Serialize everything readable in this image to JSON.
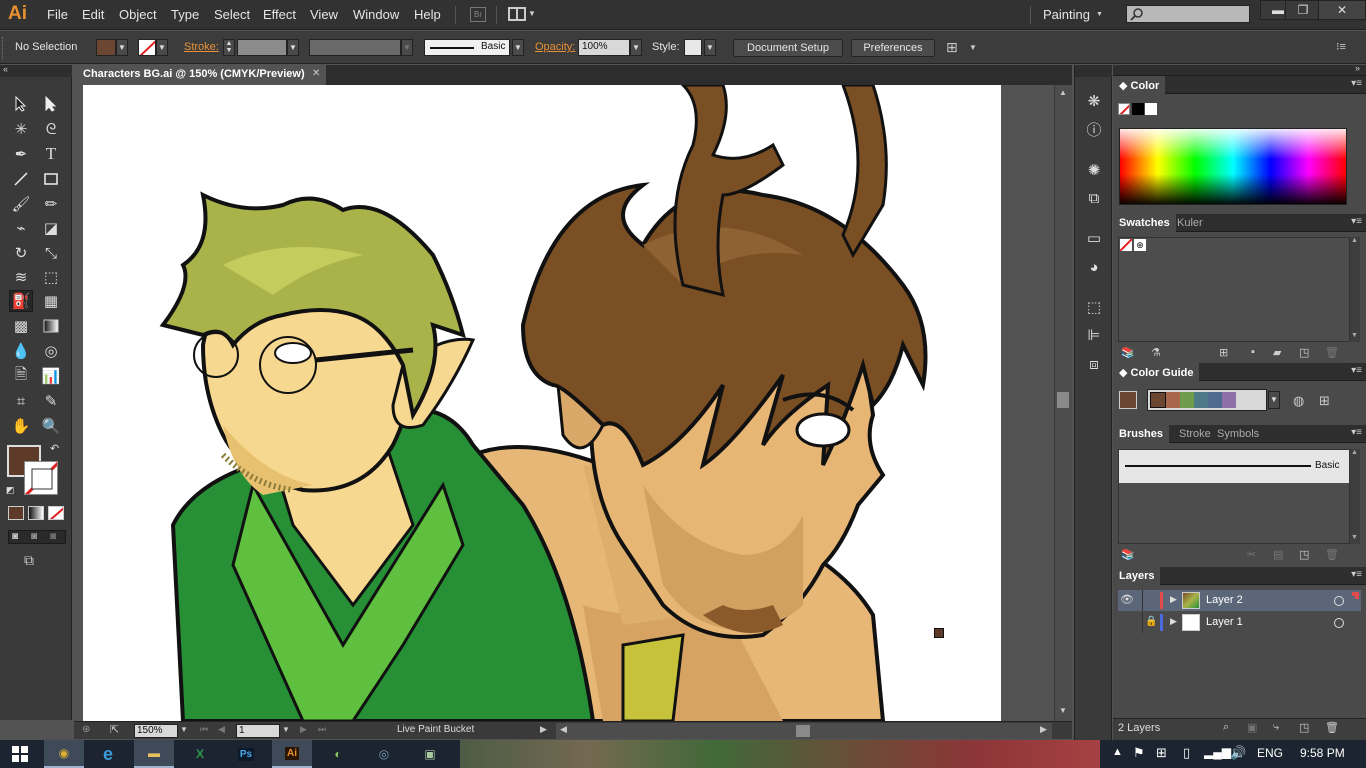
{
  "app": {
    "logo": "Ai"
  },
  "menu": [
    "File",
    "Edit",
    "Object",
    "Type",
    "Select",
    "Effect",
    "View",
    "Window",
    "Help"
  ],
  "bridge_icon": "Br",
  "workspace": {
    "label": "Painting"
  },
  "window_controls": {
    "minimize": "▬",
    "restore": "❐",
    "close": "✕"
  },
  "control_bar": {
    "selection": "No Selection",
    "stroke_label": "Stroke:",
    "brush_label": "Basic",
    "opacity_label": "Opacity:",
    "opacity_value": "100%",
    "style_label": "Style:",
    "document_setup": "Document Setup",
    "preferences": "Preferences",
    "fill_color": "#6b4632"
  },
  "document": {
    "tab_title": "Characters BG.ai @ 150% (CMYK/Preview)",
    "close": "✕"
  },
  "status_bar": {
    "zoom": "150%",
    "artboard": "1",
    "tool_name": "Live Paint Bucket"
  },
  "toolbar": {
    "tools": [
      "selection-tool",
      "direct-selection-tool",
      "magic-wand-tool",
      "lasso-tool",
      "pen-tool",
      "type-tool",
      "line-tool",
      "rectangle-tool",
      "paintbrush-tool",
      "pencil-tool",
      "blob-brush-tool",
      "eraser-tool",
      "rotate-tool",
      "scale-tool",
      "width-tool",
      "free-transform-tool",
      "live-paint-bucket-tool",
      "graph-tool",
      "mesh-tool",
      "gradient-tool",
      "eyedropper-tool",
      "blend-tool",
      "symbol-sprayer-tool",
      "column-graph-tool",
      "artboard-tool",
      "slice-tool",
      "hand-tool",
      "zoom-tool"
    ],
    "fill_color": "#5e3a28"
  },
  "panels": {
    "color": {
      "title": "Color"
    },
    "swatches": {
      "tabs": [
        "Swatches",
        "Kuler"
      ]
    },
    "color_guide": {
      "title": "Color Guide",
      "harmony_colors": [
        "#6b4632",
        "#a8674a",
        "#6f9c4a",
        "#4d7a86",
        "#4e6a8e",
        "#8e6fa8"
      ]
    },
    "brushes": {
      "tabs": [
        "Brushes",
        "Stroke",
        "Symbols"
      ],
      "brush_name": "Basic"
    },
    "layers": {
      "title": "Layers",
      "items": [
        {
          "name": "Layer 2",
          "color": "#e04a4a"
        },
        {
          "name": "Layer 1",
          "color": "#4a6ae0"
        }
      ],
      "count": "2 Layers"
    }
  },
  "taskbar": {
    "language": "ENG",
    "time": "9:58 PM",
    "apps": [
      {
        "name": "Chrome",
        "glyph": "◉",
        "color": "#e0b030"
      },
      {
        "name": "Internet Explorer",
        "glyph": "e",
        "color": "#3a9ad9"
      },
      {
        "name": "File Explorer",
        "glyph": "▬",
        "color": "#e8c060"
      },
      {
        "name": "Excel",
        "glyph": "X",
        "color": "#2a9a4a"
      },
      {
        "name": "Photoshop",
        "glyph": "Ps",
        "color": "#4aa8e8"
      },
      {
        "name": "Illustrator",
        "glyph": "Ai",
        "color": "#e8912d"
      },
      {
        "name": "App 7",
        "glyph": "◐",
        "color": "#8ac860"
      },
      {
        "name": "App 8",
        "glyph": "◎",
        "color": "#7a9ab8"
      },
      {
        "name": "App 9",
        "glyph": "▣",
        "color": "#a8c8a0"
      }
    ]
  }
}
